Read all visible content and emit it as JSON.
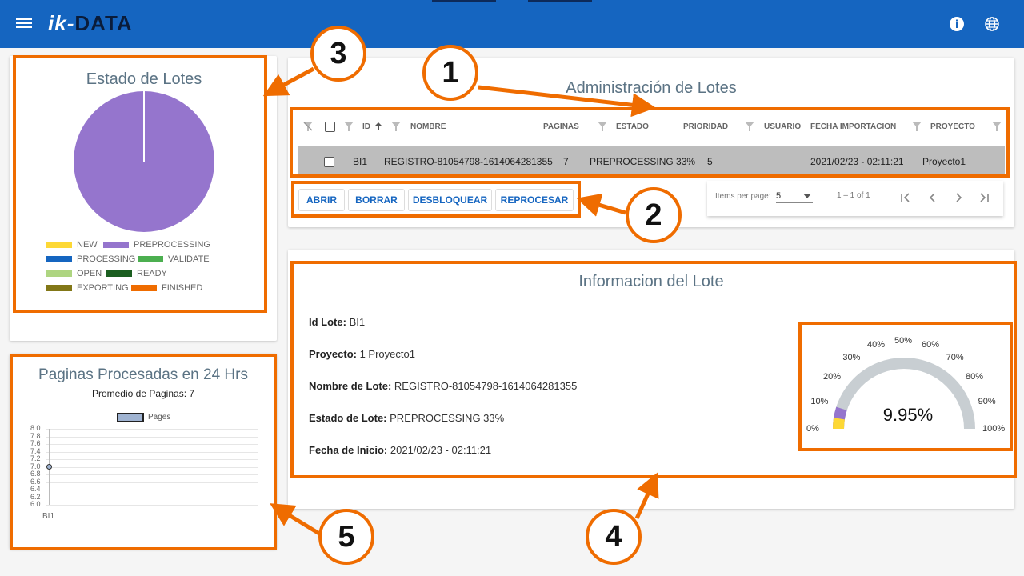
{
  "header": {
    "logo_prefix": "ik",
    "logo_dash": "-",
    "logo_suffix": "DATA",
    "bg_color": "#1565c0",
    "icons": [
      "menu-icon",
      "info-icon",
      "globe-icon"
    ]
  },
  "estado": {
    "title": "Estado de Lotes",
    "legend": [
      {
        "label": "NEW",
        "color": "#fdd835"
      },
      {
        "label": "PREPROCESSING",
        "color": "#9575cd"
      },
      {
        "label": "PROCESSING",
        "color": "#1565c0"
      },
      {
        "label": "VALIDATE",
        "color": "#4caf50"
      },
      {
        "label": "OPEN",
        "color": "#aed581"
      },
      {
        "label": "READY",
        "color": "#1b5e20"
      },
      {
        "label": "EXPORTING",
        "color": "#827717"
      },
      {
        "label": "FINISHED",
        "color": "#ef6c00"
      }
    ],
    "chart_data": {
      "type": "pie",
      "categories": [
        "NEW",
        "PREPROCESSING",
        "PROCESSING",
        "VALIDATE",
        "OPEN",
        "READY",
        "EXPORTING",
        "FINISHED"
      ],
      "values": [
        0,
        1,
        0,
        0,
        0,
        0,
        0,
        0
      ]
    }
  },
  "paginas": {
    "title": "Paginas Procesadas en 24 Hrs",
    "subtitle": "Promedio de Paginas: 7",
    "legend": "Pages",
    "chart_data": {
      "type": "line",
      "categories": [
        "BI1"
      ],
      "series": [
        {
          "name": "Pages",
          "values": [
            7
          ]
        }
      ],
      "ylim": [
        6.0,
        8.0
      ],
      "yticks": [
        "8.0",
        "7.8",
        "7.6",
        "7.4",
        "7.2",
        "7.0",
        "6.8",
        "6.6",
        "6.4",
        "6.2",
        "6.0"
      ]
    }
  },
  "admin": {
    "title": "Administración de Lotes",
    "columns": {
      "id": "ID",
      "nombre": "NOMBRE",
      "paginas": "PAGINAS",
      "estado": "ESTADO",
      "prioridad": "PRIORIDAD",
      "usuario": "USUARIO",
      "fecha": "FECHA IMPORTACION",
      "proyecto": "PROYECTO"
    },
    "rows": [
      {
        "id": "BI1",
        "nombre": "REGISTRO-81054798-1614064281355",
        "paginas": "7",
        "estado": "PREPROCESSING 33%",
        "prioridad": "5",
        "usuario": "",
        "fecha": "2021/02/23 - 02:11:21",
        "proyecto": "Proyecto1"
      }
    ],
    "buttons": {
      "abrir": "ABRIR",
      "borrar": "BORRAR",
      "desbloquear": "DESBLOQUEAR",
      "reprocesar": "REPROCESAR"
    },
    "pager": {
      "items_label": "Items per page:",
      "items_value": "5",
      "range": "1 – 1 of 1"
    }
  },
  "info": {
    "title": "Informacion del Lote",
    "fields": [
      {
        "label": "Id Lote:",
        "value": "BI1"
      },
      {
        "label": "Proyecto:",
        "value": "1 Proyecto1"
      },
      {
        "label": "Nombre de Lote:",
        "value": "REGISTRO-81054798-1614064281355"
      },
      {
        "label": "Estado de Lote:",
        "value": "PREPROCESSING 33%"
      },
      {
        "label": "Fecha de Inicio:",
        "value": "2021/02/23 - 02:11:21"
      }
    ],
    "gauge": {
      "value_label": "9.95%",
      "value": 9.95,
      "ticks": [
        "0%",
        "10%",
        "20%",
        "30%",
        "40%",
        "50%",
        "60%",
        "70%",
        "80%",
        "90%",
        "100%"
      ]
    }
  },
  "badges": [
    "1",
    "2",
    "3",
    "4",
    "5"
  ],
  "accent": "#ef6c00"
}
